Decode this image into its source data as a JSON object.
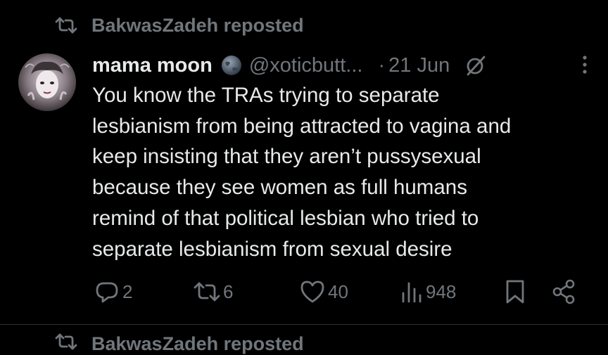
{
  "colors": {
    "background": "#000000",
    "text_primary": "#e7e9ea",
    "text_secondary": "#71767b",
    "divider": "#2f3336"
  },
  "repost": {
    "icon": "repost-icon",
    "text": "BakwasZadeh reposted"
  },
  "tweet": {
    "avatar": "user-avatar",
    "display_name": "mama moon",
    "badge_icon": "globe-icon",
    "handle": "@xoticbutt...",
    "separator": "·",
    "date": "21 Jun",
    "grok_icon": "grok-icon",
    "more_icon": "more-options-icon",
    "text": "You know the TRAs trying to separate\nlesbianism from being attracted to vagina and\nkeep insisting that they aren’t pussysexual\nbecause they see women as full humans\nremind of that political lesbian who tried to\nseparate lesbianism from sexual desire"
  },
  "actions": {
    "replies": "2",
    "reposts": "6",
    "likes": "40",
    "views": "948"
  },
  "next_item": {
    "text": "BakwasZadeh reposted"
  }
}
